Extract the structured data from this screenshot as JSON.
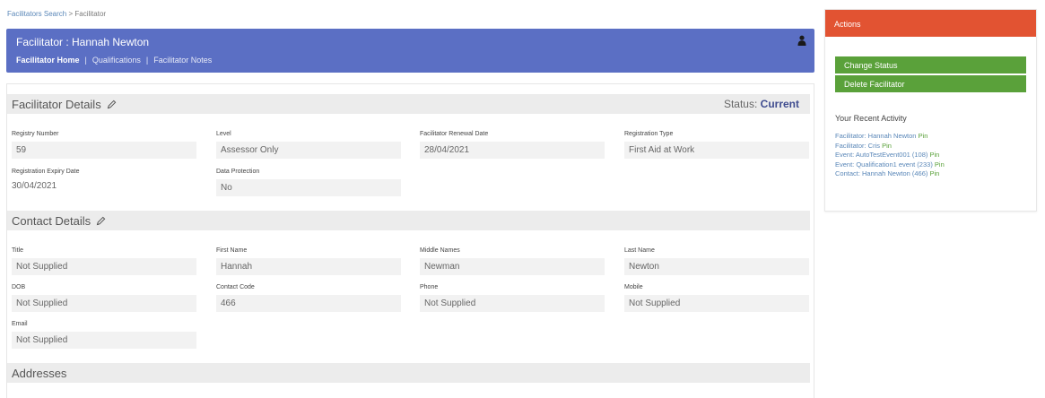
{
  "breadcrumb": {
    "parent": "Facilitators Search",
    "separator": " > ",
    "current": "Facilitator"
  },
  "header": {
    "title": "Facilitator : Hannah Newton",
    "tabs": [
      "Facilitator Home",
      "Qualifications",
      "Facilitator Notes"
    ],
    "separator": "|",
    "icon": "person-icon"
  },
  "facilitator_details": {
    "title": "Facilitator Details",
    "status_label": "Status:",
    "status_value": "Current",
    "fields": [
      {
        "label": "Registry Number",
        "value": "59"
      },
      {
        "label": "Level",
        "value": "Assessor Only"
      },
      {
        "label": "Facilitator Renewal Date",
        "value": "28/04/2021"
      },
      {
        "label": "Registration Type",
        "value": "First Aid at Work"
      },
      {
        "label": "Registration Expiry Date",
        "value": "30/04/2021"
      },
      {
        "label": "Data Protection",
        "value": "No"
      }
    ]
  },
  "contact_details": {
    "title": "Contact Details",
    "fields": [
      {
        "label": "Title",
        "value": "Not Supplied"
      },
      {
        "label": "First Name",
        "value": "Hannah"
      },
      {
        "label": "Middle Names",
        "value": "Newman"
      },
      {
        "label": "Last Name",
        "value": "Newton"
      },
      {
        "label": "DOB",
        "value": "Not Supplied"
      },
      {
        "label": "Contact Code",
        "value": "466"
      },
      {
        "label": "Phone",
        "value": "Not Supplied"
      },
      {
        "label": "Mobile",
        "value": "Not Supplied"
      },
      {
        "label": "Email",
        "value": "Not Supplied"
      }
    ]
  },
  "addresses": {
    "title": "Addresses"
  },
  "actions": {
    "title": "Actions",
    "buttons": [
      "Change Status",
      "Delete Facilitator"
    ],
    "recent_title": "Your Recent Activity",
    "pin_label": "Pin",
    "recent": [
      "Facilitator: Hannah Newton",
      "Facilitator: Cris",
      "Event: AutoTestEvent001 (108)",
      "Event: Qualification1 event (233)",
      "Contact: Hannah Newton (466)"
    ]
  },
  "colors": {
    "header_bg": "#5b6fc4",
    "actions_header": "#e25332",
    "action_button": "#5aa13a",
    "link": "#5a87b8",
    "status_value": "#3f4c8f"
  }
}
